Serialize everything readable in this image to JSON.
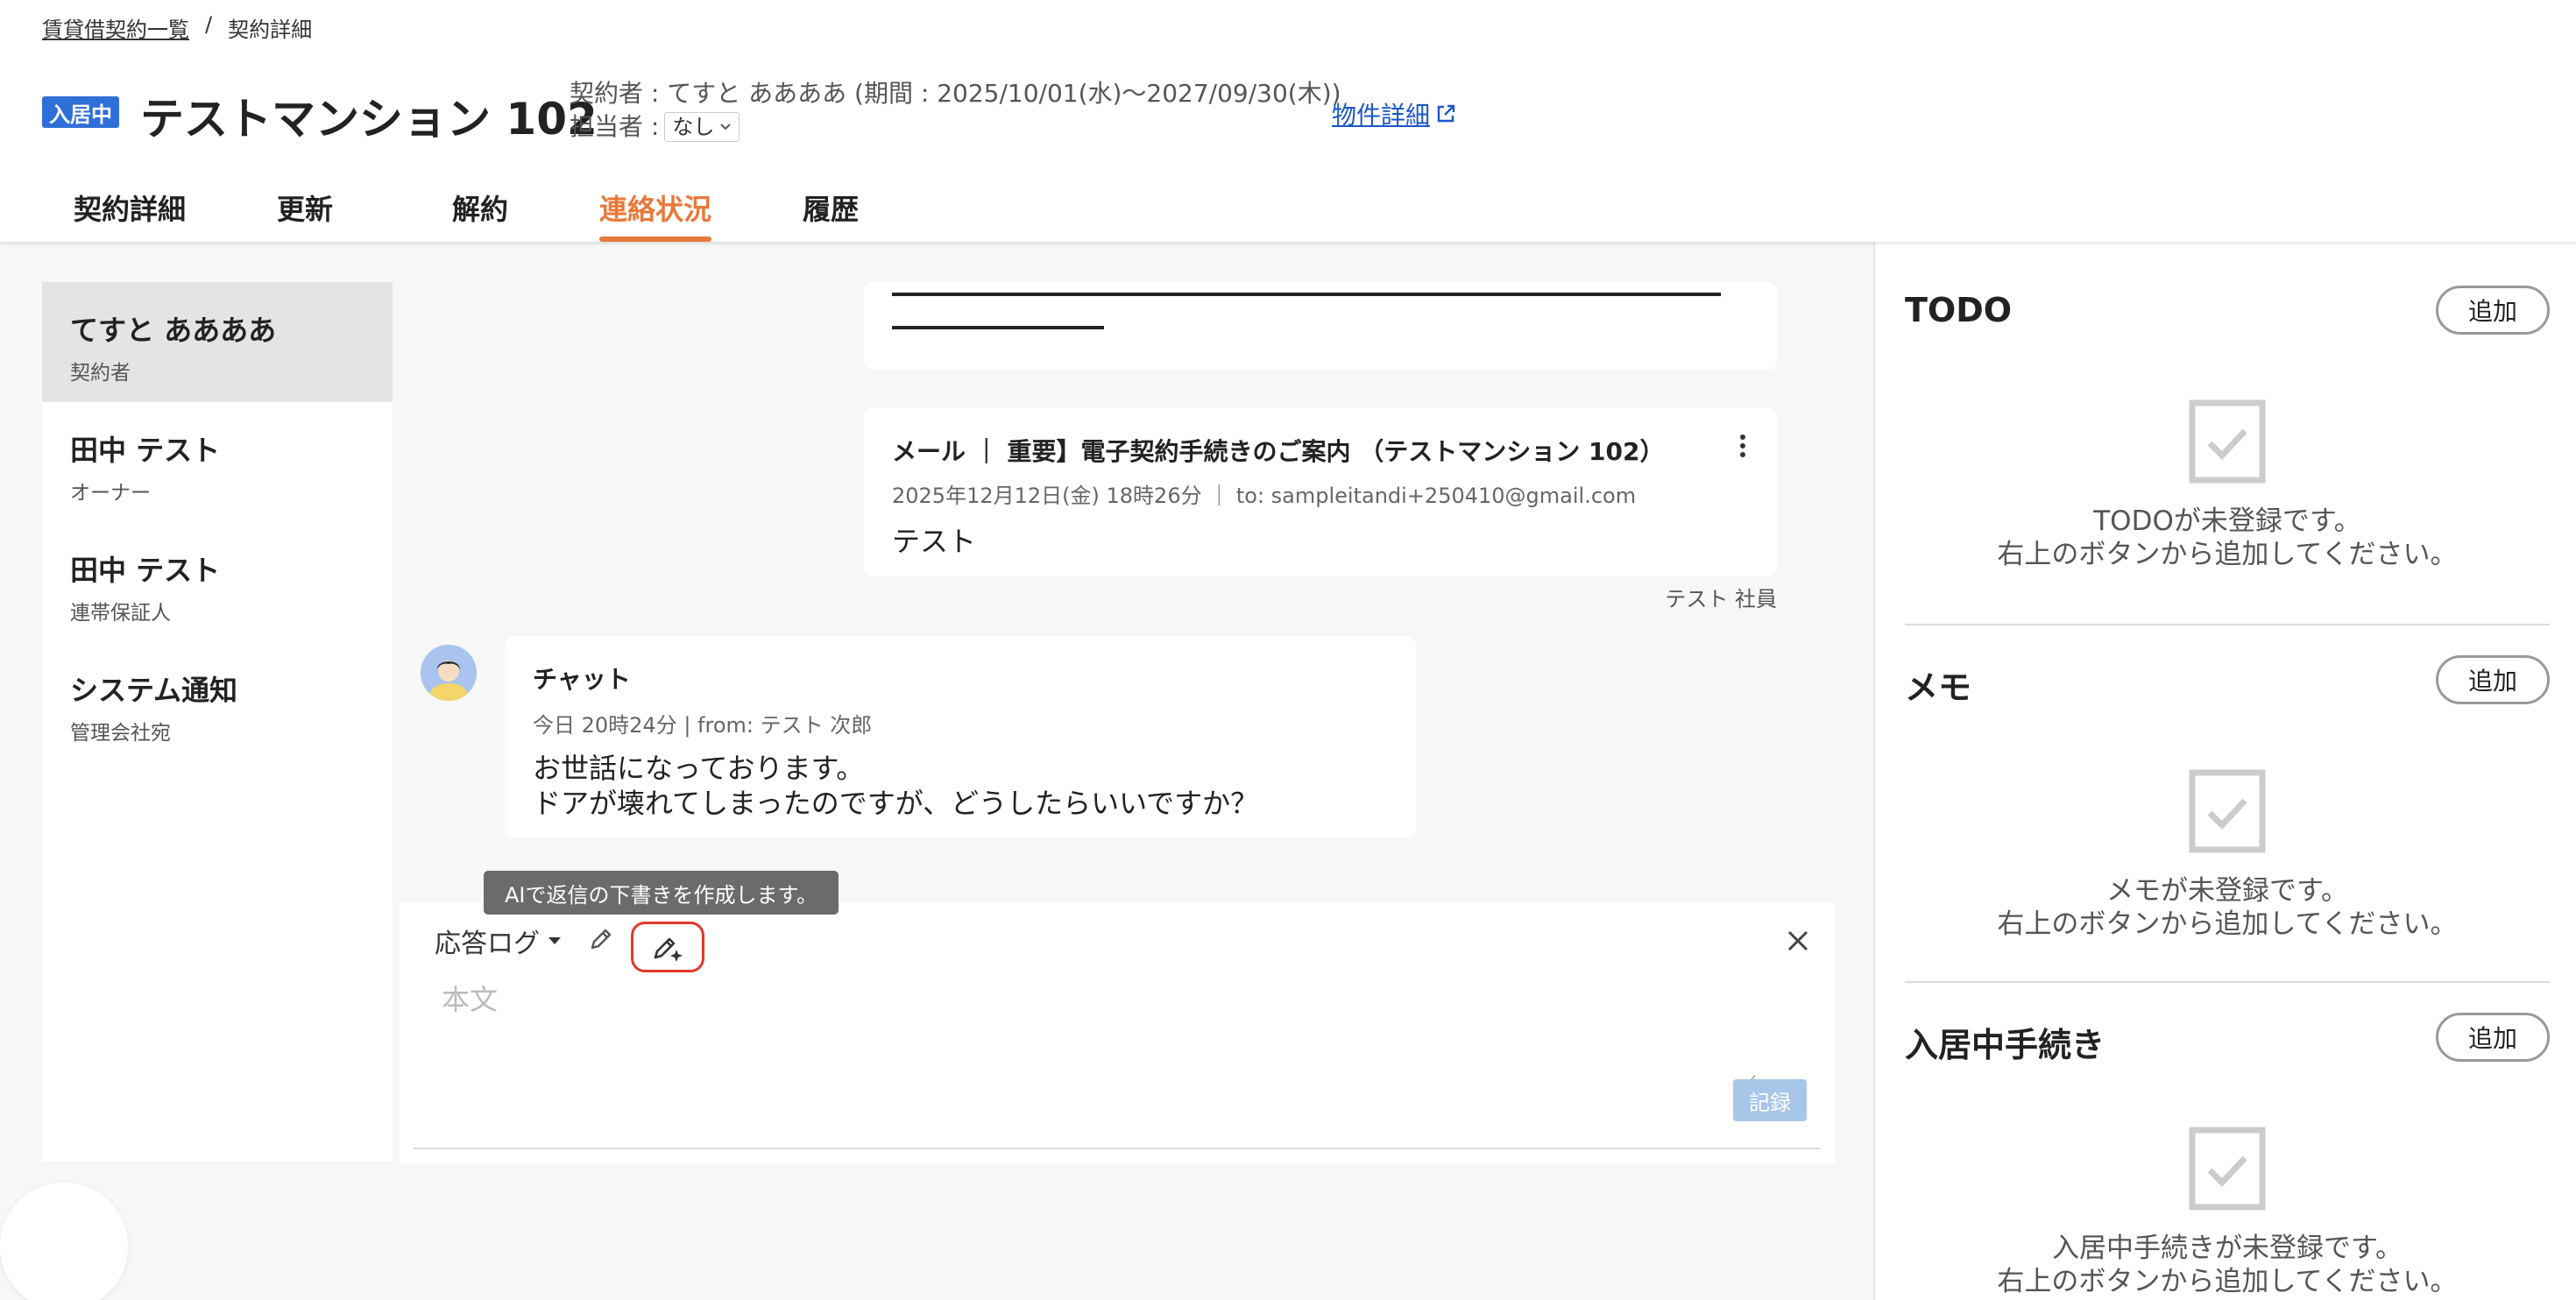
{
  "breadcrumb": {
    "parent": "賃貸借契約一覧",
    "separator": "/",
    "current": "契約詳細"
  },
  "header": {
    "status_badge": "入居中",
    "title": "テストマンション 102",
    "contractor_line": "契約者 : てすと ああああ (期間 : 2025/10/01(水)〜2027/09/30(木))",
    "assignee_label": "担当者 :",
    "assignee_value": "なし",
    "property_link": "物件詳細"
  },
  "tabs": [
    {
      "label": "契約詳細",
      "active": false
    },
    {
      "label": "更新",
      "active": false
    },
    {
      "label": "解約",
      "active": false
    },
    {
      "label": "連絡状況",
      "active": true
    },
    {
      "label": "履歴",
      "active": false
    }
  ],
  "contacts": [
    {
      "name": "てすと ああああ",
      "role": "契約者",
      "active": true
    },
    {
      "name": "田中 テスト",
      "role": "オーナー",
      "active": false
    },
    {
      "name": "田中 テスト",
      "role": "連帯保証人",
      "active": false
    },
    {
      "name": "システム通知",
      "role": "管理会社宛",
      "active": false
    }
  ],
  "mail_card": {
    "title": "メール ｜ 重要】電子契約手続きのご案内 （テストマンション 102）",
    "meta": "2025年12月12日(金) 18時26分 ｜ to: sampleitandi+250410@gmail.com",
    "body": "テスト",
    "sender": "テスト 社員"
  },
  "chat_card": {
    "title": "チャット",
    "meta": "今日 20時24分 | from: テスト 次郎",
    "body": "お世話になっております。\nドアが壊れてしまったのですが、どうしたらいいですか？"
  },
  "composer": {
    "log_select": "応答ログ",
    "tooltip": "AIで返信の下書きを作成します。",
    "placeholder": "本文",
    "record_button": "記録"
  },
  "right_panel": {
    "sections": [
      {
        "title": "TODO",
        "add_label": "追加",
        "empty_text": "TODOが未登録です。\n右上のボタンから追加してください。"
      },
      {
        "title": "メモ",
        "add_label": "追加",
        "empty_text": "メモが未登録です。\n右上のボタンから追加してください。"
      },
      {
        "title": "入居中手続き",
        "add_label": "追加",
        "empty_text": "入居中手続きが未登録です。\n右上のボタンから追加してください。"
      }
    ]
  },
  "colors": {
    "accent": "#e8793a",
    "badge": "#2f6fd8",
    "link": "#1a57c8",
    "ai_highlight": "#e0392b",
    "record_disabled": "#a8c6e8"
  }
}
